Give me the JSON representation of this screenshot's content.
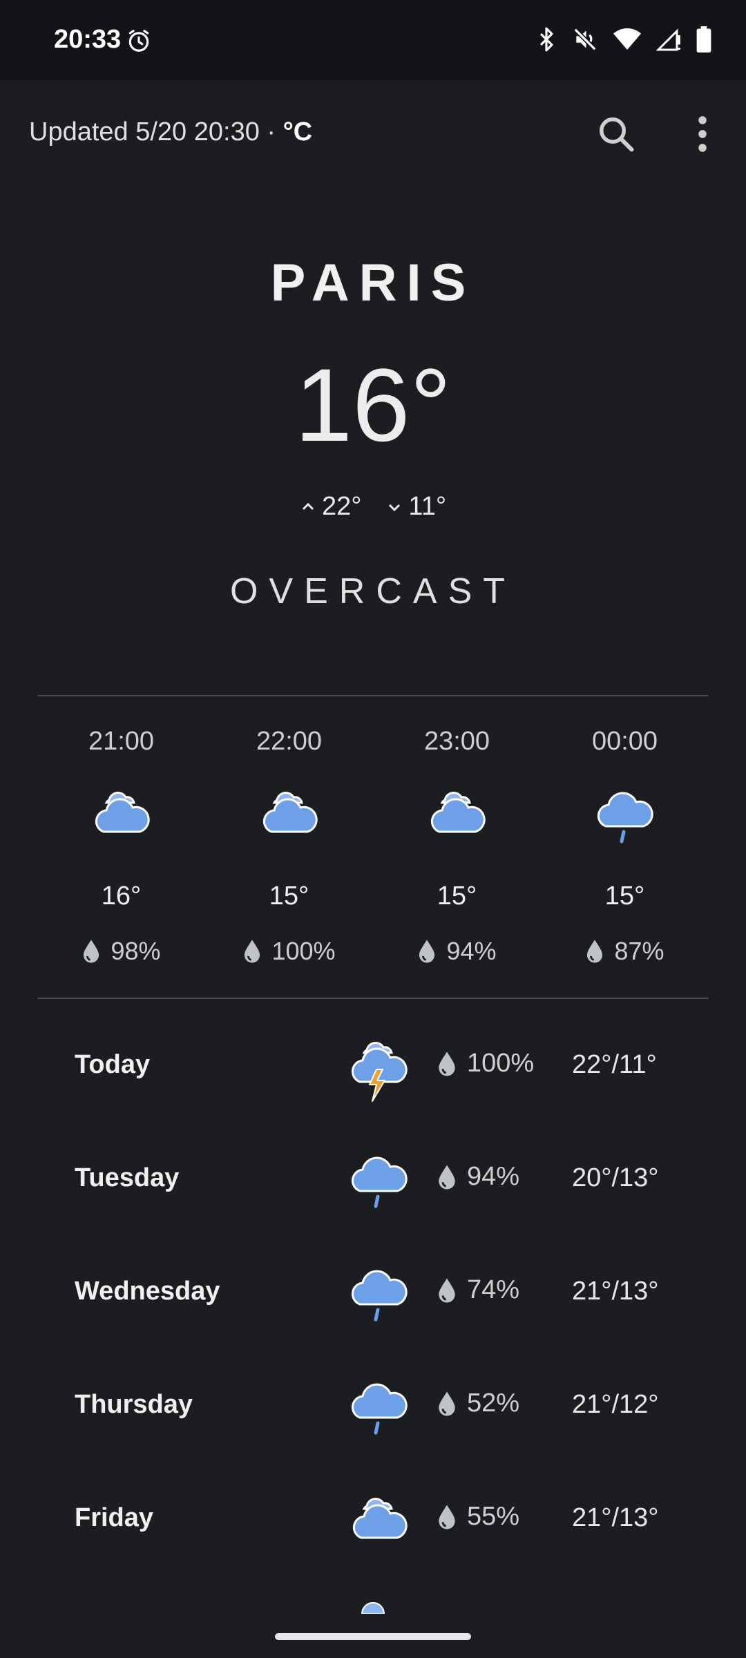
{
  "status_bar": {
    "time": "20:33",
    "icons": [
      "alarm-icon",
      "bluetooth-icon",
      "mute-icon",
      "wifi-icon",
      "signal-icon",
      "battery-icon"
    ]
  },
  "header": {
    "updated_prefix": "Updated 5/20 20:30 · ",
    "unit": "°C",
    "actions": [
      "search-icon",
      "more-vert-icon"
    ]
  },
  "current": {
    "city": "PARIS",
    "temp": "16°",
    "high": "22°",
    "low": "11°",
    "condition": "OVERCAST"
  },
  "hourly": [
    {
      "time": "21:00",
      "icon": "partly-cloudy-icon",
      "temp": "16°",
      "precip": "98%"
    },
    {
      "time": "22:00",
      "icon": "partly-cloudy-icon",
      "temp": "15°",
      "precip": "100%"
    },
    {
      "time": "23:00",
      "icon": "partly-cloudy-icon",
      "temp": "15°",
      "precip": "94%"
    },
    {
      "time": "00:00",
      "icon": "rain-icon",
      "temp": "15°",
      "precip": "87%"
    }
  ],
  "daily": [
    {
      "day": "Today",
      "icon": "thunderstorm-icon",
      "precip": "100%",
      "range": "22°/11°"
    },
    {
      "day": "Tuesday",
      "icon": "rain-icon",
      "precip": "94%",
      "range": "20°/13°"
    },
    {
      "day": "Wednesday",
      "icon": "rain-icon",
      "precip": "74%",
      "range": "21°/13°"
    },
    {
      "day": "Thursday",
      "icon": "rain-icon",
      "precip": "52%",
      "range": "21°/12°"
    },
    {
      "day": "Friday",
      "icon": "partly-cloudy-icon",
      "precip": "55%",
      "range": "21°/13°"
    }
  ],
  "colors": {
    "background": "#1b1d21",
    "cloud": "#6ea0e8",
    "lightning": "#f0a030"
  }
}
